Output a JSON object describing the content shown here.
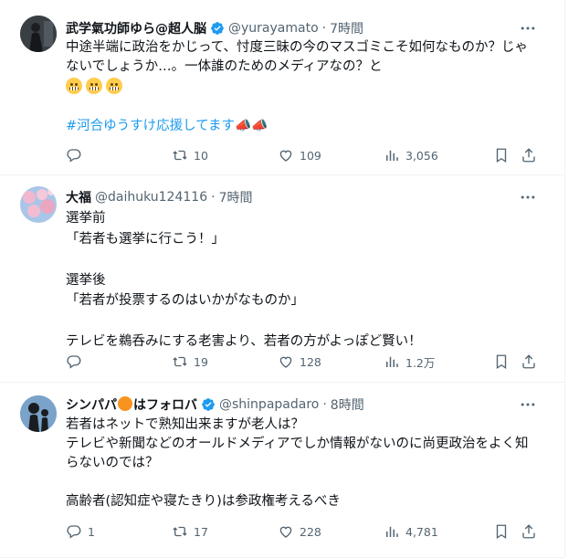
{
  "tweets": [
    {
      "name": "武学氣功師ゆら@超人脳",
      "handle": "@yurayamato",
      "dot": "·",
      "time": "7時間",
      "text1": "中途半端に政治をかじって、忖度三昧の今のマスゴミこそ如何なものか？じゃないでしょうか…。一体誰のためのメディアなの？と",
      "hashtag": "#河合ゆうすけ応援してます",
      "hashtag_suffix": "📣📣",
      "reply": "",
      "retweet": "10",
      "like": "109",
      "views": "3,056"
    },
    {
      "name": "大福",
      "handle": "@daihuku124116",
      "dot": "·",
      "time": "7時間",
      "text": "選挙前\n「若者も選挙に行こう！」\n\n選挙後\n「若者が投票するのはいかがなものか」\n\nテレビを鵜呑みにする老害より、若者の方がよっぽど賢い！",
      "reply": "",
      "retweet": "19",
      "like": "128",
      "views": "1.2万"
    },
    {
      "name_prefix": "シンパパ",
      "name_suffix": "はフォロバ",
      "handle": "@shinpapadaro",
      "dot": "·",
      "time": "8時間",
      "text": "若者はネットで熟知出来ますが老人は？\nテレビや新聞などのオールドメディアでしか情報がないのに尚更政治をよく知らないのでは？\n\n高齢者(認知症や寝たきり)は参政権考えるべき",
      "reply": "1",
      "retweet": "17",
      "like": "228",
      "views": "4,781"
    }
  ],
  "colors": {
    "verified": "#1d9bf0",
    "hashtag": "#1d9bf0",
    "muted": "#536471"
  },
  "icons": [
    "verified-badge-icon",
    "more-icon",
    "reply-icon",
    "retweet-icon",
    "like-icon",
    "views-icon",
    "bookmark-icon",
    "share-icon"
  ]
}
